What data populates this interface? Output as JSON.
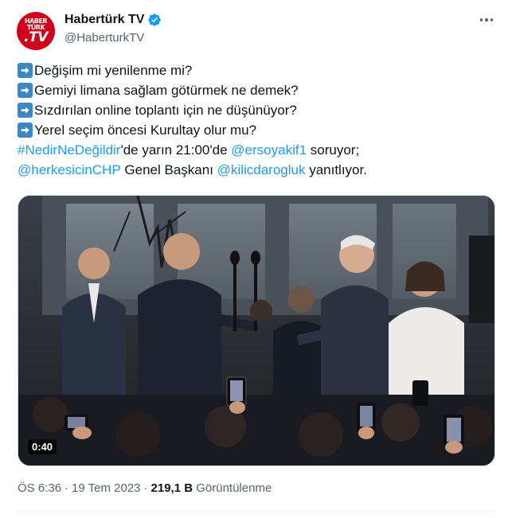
{
  "account": {
    "display_name": "Habertürk TV",
    "handle": "@HaberturkTV",
    "avatar_text": [
      "HABER",
      "TÜRK",
      ".TV"
    ],
    "verified": true
  },
  "tweet": {
    "line1": "Değişim mi yenilenme mi?",
    "line2": "Gemiyi limana sağlam götürmek ne demek?",
    "line3": "Sızdırılan online toplantı için ne düşünüyor?",
    "line4": "Yerel seçim öncesi Kurultay olur mu?",
    "hashtag": "#NedirNeDeğildir",
    "line5_mid": "'de yarın 21:00'de ",
    "mention1": "@ersoyakif1",
    "line5_end": " soruyor;",
    "mention2": "@herkesicinCHP",
    "line6_mid": " Genel Başkanı ",
    "mention3": "@kilicdarogluk",
    "line6_end": " yanıtlıyor."
  },
  "media": {
    "duration": "0:40"
  },
  "meta": {
    "time": "ÖS 6:36",
    "separator": "·",
    "date": "19 Tem 2023",
    "separator2": "·",
    "views_count": "219,1 B",
    "views_label": "Görüntülenme"
  },
  "colors": {
    "link": "#1d9bf0",
    "text": "#0f1419",
    "secondary": "#536471",
    "verified": "#1d9bf0",
    "brand": "#d0021b"
  },
  "icons": {
    "verified": "verified-badge-icon",
    "more": "more-options-icon",
    "arrow": "right-arrow-emoji-icon"
  }
}
